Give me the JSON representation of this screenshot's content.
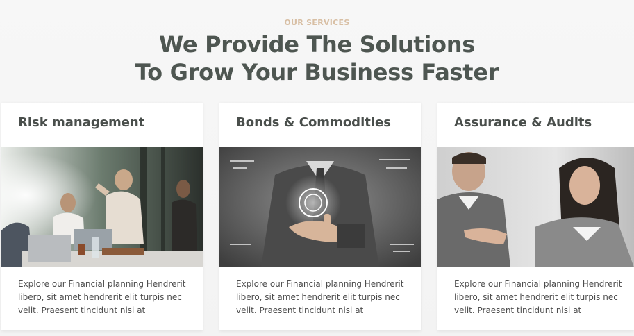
{
  "section": {
    "eyebrow": "OUR SERVICES",
    "headline_line1": "We Provide The Solutions",
    "headline_line2": "To Grow Your Business Faster"
  },
  "colors": {
    "eyebrow": "#d8bfa4",
    "headline": "#4e5651",
    "card_background": "#ffffff",
    "page_background": "#f6f6f6"
  },
  "cards": [
    {
      "title": "Risk management",
      "image": "office-team-celebrating-photo",
      "text": "Explore our Financial planning Hendrerit libero, sit amet hendrerit elit turpis nec velit. Praesent tincidunt nisi at"
    },
    {
      "title": "Bonds & Commodities",
      "image": "businessman-touching-digital-interface-photo",
      "text": "Explore our Financial planning Hendrerit libero, sit amet hendrerit elit turpis nec velit. Praesent tincidunt nisi at"
    },
    {
      "title": "Assurance & Audits",
      "image": "two-colleagues-discussing-photo",
      "text": "Explore our Financial planning Hendrerit libero, sit amet hendrerit elit turpis nec velit. Praesent tincidunt nisi at"
    }
  ]
}
